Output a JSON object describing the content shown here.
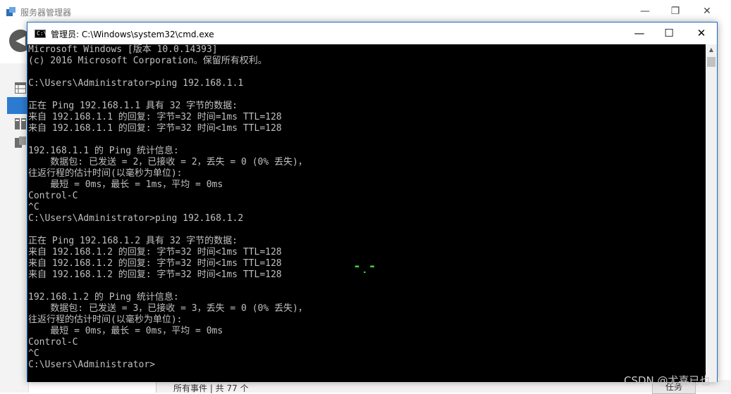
{
  "background_window": {
    "title": "服务器管理器",
    "status_text": "所有事件 | 共 77 个",
    "tasks_label": "任务"
  },
  "cmd_window": {
    "title": "管理员: C:\\Windows\\system32\\cmd.exe",
    "icon_text": "C:\\",
    "console_lines": [
      "Microsoft Windows [版本 10.0.14393]",
      "(c) 2016 Microsoft Corporation。保留所有权利。",
      "",
      "C:\\Users\\Administrator>ping 192.168.1.1",
      "",
      "正在 Ping 192.168.1.1 具有 32 字节的数据:",
      "来自 192.168.1.1 的回复: 字节=32 时间=1ms TTL=128",
      "来自 192.168.1.1 的回复: 字节=32 时间<1ms TTL=128",
      "",
      "192.168.1.1 的 Ping 统计信息:",
      "    数据包: 已发送 = 2，已接收 = 2，丢失 = 0 (0% 丢失)，",
      "往返行程的估计时间(以毫秒为单位):",
      "    最短 = 0ms，最长 = 1ms，平均 = 0ms",
      "Control-C",
      "^C",
      "C:\\Users\\Administrator>ping 192.168.1.2",
      "",
      "正在 Ping 192.168.1.2 具有 32 字节的数据:",
      "来自 192.168.1.2 的回复: 字节=32 时间<1ms TTL=128",
      "来自 192.168.1.2 的回复: 字节=32 时间<1ms TTL=128",
      "来自 192.168.1.2 的回复: 字节=32 时间<1ms TTL=128",
      "",
      "192.168.1.2 的 Ping 统计信息:",
      "    数据包: 已发送 = 3，已接收 = 3，丢失 = 0 (0% 丢失)，",
      "往返行程的估计时间(以毫秒为单位):",
      "    最短 = 0ms，最长 = 0ms，平均 = 0ms",
      "Control-C",
      "^C",
      "C:\\Users\\Administrator>"
    ],
    "console_text_color": "#c0c0c0",
    "console_bg_color": "#000000",
    "cursor_glyph": "-̣-"
  },
  "watermark": "CSDN @尤喜已也",
  "icons": {
    "minimize": "—",
    "maximize": "☐",
    "close": "✕",
    "restore": "❐",
    "back": "◀",
    "scroll_up": "▲"
  }
}
